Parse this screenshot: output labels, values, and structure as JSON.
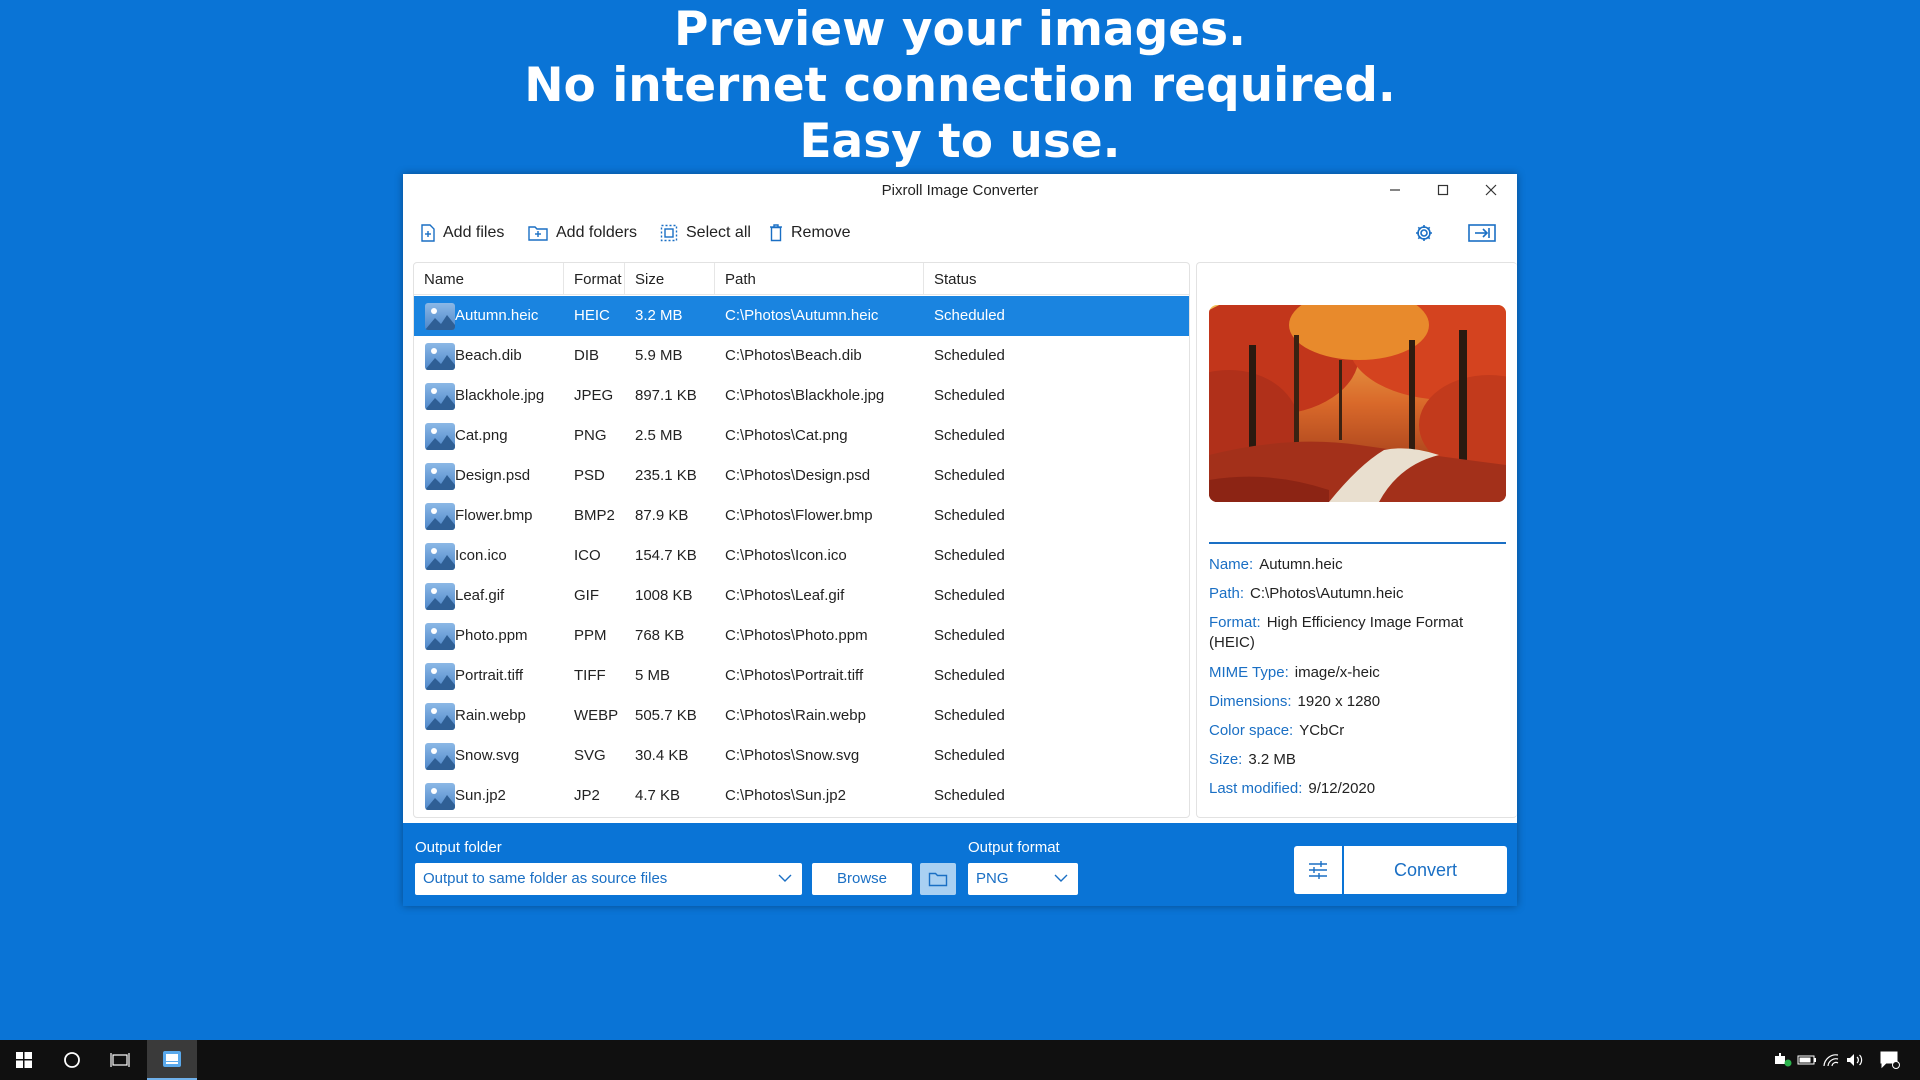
{
  "headline": {
    "line1": "Preview your images.",
    "line2": "No internet connection required.",
    "line3": "Easy to use."
  },
  "window": {
    "title": "Pixroll Image Converter"
  },
  "toolbar": {
    "add_files": "Add files",
    "add_folders": "Add folders",
    "select_all": "Select all",
    "remove": "Remove"
  },
  "table": {
    "headers": [
      "Name",
      "Format",
      "Size",
      "Path",
      "Status"
    ],
    "rows": [
      {
        "name": "Autumn.heic",
        "format": "HEIC",
        "size": "3.2 MB",
        "path": "C:\\Photos\\Autumn.heic",
        "status": "Scheduled",
        "selected": true
      },
      {
        "name": "Beach.dib",
        "format": "DIB",
        "size": "5.9 MB",
        "path": "C:\\Photos\\Beach.dib",
        "status": "Scheduled"
      },
      {
        "name": "Blackhole.jpg",
        "format": "JPEG",
        "size": "897.1 KB",
        "path": "C:\\Photos\\Blackhole.jpg",
        "status": "Scheduled"
      },
      {
        "name": "Cat.png",
        "format": "PNG",
        "size": "2.5 MB",
        "path": "C:\\Photos\\Cat.png",
        "status": "Scheduled"
      },
      {
        "name": "Design.psd",
        "format": "PSD",
        "size": "235.1 KB",
        "path": "C:\\Photos\\Design.psd",
        "status": "Scheduled"
      },
      {
        "name": "Flower.bmp",
        "format": "BMP2",
        "size": "87.9 KB",
        "path": "C:\\Photos\\Flower.bmp",
        "status": "Scheduled"
      },
      {
        "name": "Icon.ico",
        "format": "ICO",
        "size": "154.7 KB",
        "path": "C:\\Photos\\Icon.ico",
        "status": "Scheduled"
      },
      {
        "name": "Leaf.gif",
        "format": "GIF",
        "size": "1008 KB",
        "path": "C:\\Photos\\Leaf.gif",
        "status": "Scheduled"
      },
      {
        "name": "Photo.ppm",
        "format": "PPM",
        "size": "768 KB",
        "path": "C:\\Photos\\Photo.ppm",
        "status": "Scheduled"
      },
      {
        "name": "Portrait.tiff",
        "format": "TIFF",
        "size": "5 MB",
        "path": "C:\\Photos\\Portrait.tiff",
        "status": "Scheduled"
      },
      {
        "name": "Rain.webp",
        "format": "WEBP",
        "size": "505.7 KB",
        "path": "C:\\Photos\\Rain.webp",
        "status": "Scheduled"
      },
      {
        "name": "Snow.svg",
        "format": "SVG",
        "size": "30.4 KB",
        "path": "C:\\Photos\\Snow.svg",
        "status": "Scheduled"
      },
      {
        "name": "Sun.jp2",
        "format": "JP2",
        "size": "4.7 KB",
        "path": "C:\\Photos\\Sun.jp2",
        "status": "Scheduled"
      }
    ]
  },
  "details": {
    "name_label": "Name:",
    "name": "Autumn.heic",
    "path_label": "Path:",
    "path": "C:\\Photos\\Autumn.heic",
    "format_label": "Format:",
    "format": "High Efficiency Image Format (HEIC)",
    "mime_label": "MIME Type:",
    "mime": "image/x-heic",
    "dimensions_label": "Dimensions:",
    "dimensions": "1920 x 1280",
    "colorspace_label": "Color space:",
    "colorspace": "YCbCr",
    "size_label": "Size:",
    "size": "3.2 MB",
    "modified_label": "Last modified:",
    "modified": "9/12/2020"
  },
  "bottom": {
    "output_folder_label": "Output folder",
    "output_folder_value": "Output to same folder as source files",
    "browse": "Browse",
    "output_format_label": "Output format",
    "output_format_value": "PNG",
    "convert": "Convert"
  },
  "colors": {
    "accent": "#0a74d6",
    "selection": "#1a84e0",
    "link": "#1a6fc4"
  }
}
